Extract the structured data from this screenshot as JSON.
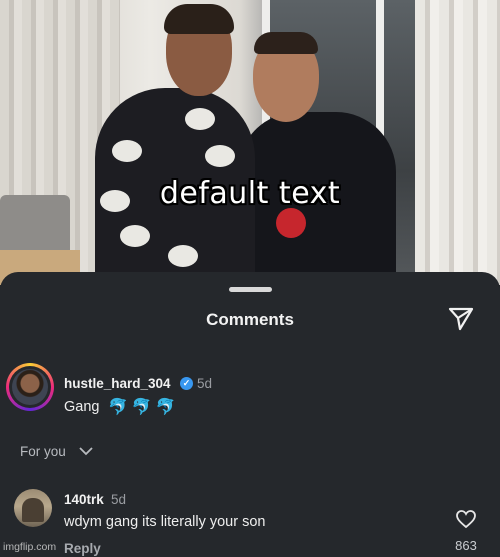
{
  "meme": {
    "caption": "default text"
  },
  "comments_sheet": {
    "title": "Comments",
    "icons": {
      "share": "paper-plane-icon",
      "like": "heart-icon",
      "dropdown": "chevron-down-icon",
      "verified": "verified-badge-icon"
    },
    "comment_1": {
      "username": "hustle_hard_304",
      "verified": true,
      "time": "5d",
      "text": "Gang",
      "emojis": [
        "🐬",
        "🐬",
        "🐬"
      ]
    },
    "section_label": "For you",
    "comment_2": {
      "username": "140trk",
      "time": "5d",
      "text": "wdym gang its literally your son",
      "reply_label": "Reply",
      "like_count": "863"
    }
  },
  "colors": {
    "sheet_background": "#25282c",
    "verified_blue": "#3897f0",
    "story_ring": [
      "#f9ce34",
      "#ee2a7b",
      "#6228d7"
    ]
  },
  "watermark": "imgflip.com"
}
